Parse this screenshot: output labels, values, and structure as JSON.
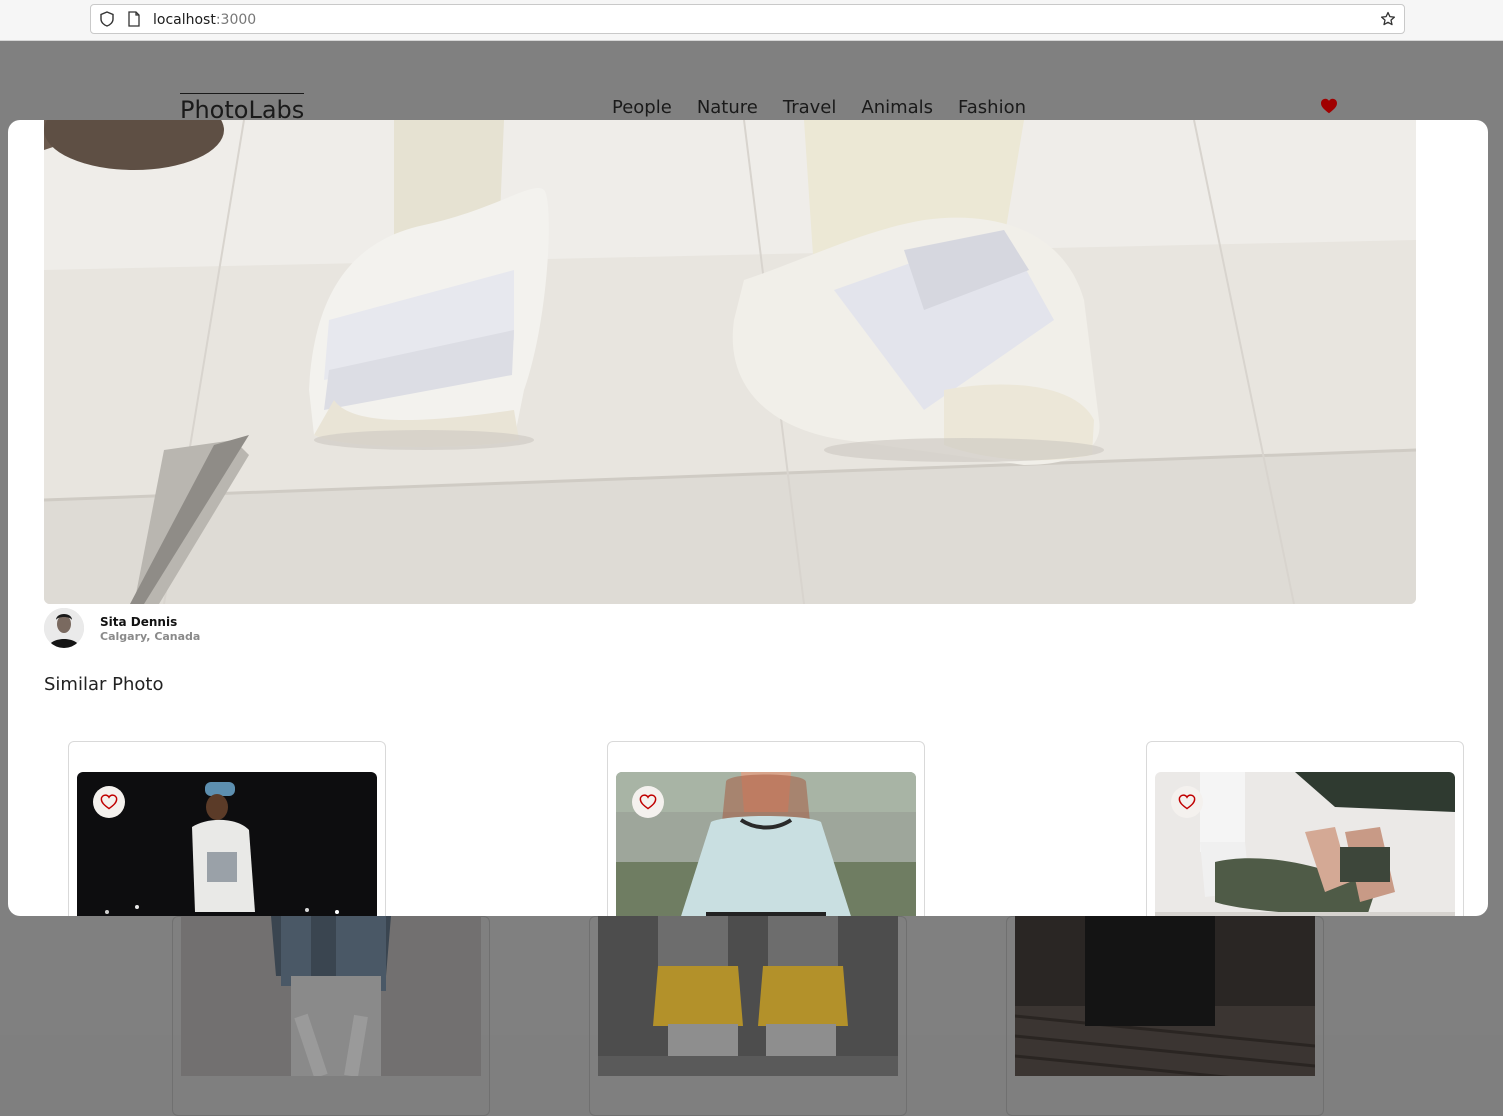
{
  "browser": {
    "url_host": "localhost",
    "url_port": ":3000"
  },
  "nav": {
    "logo": "PhotoLabs",
    "topics": [
      "People",
      "Nature",
      "Travel",
      "Animals",
      "Fashion"
    ],
    "fav_icon": "heart-filled-icon",
    "accent": "#c00000"
  },
  "modal": {
    "user": {
      "name": "Sita Dennis",
      "location": "Calgary, Canada"
    },
    "similar_heading": "Similar Photo",
    "similar_photos": [
      {
        "description": "man in cap at night",
        "fav_icon": "heart-outline-icon"
      },
      {
        "description": "woman in light blue top by lake",
        "fav_icon": "heart-outline-icon"
      },
      {
        "description": "person adjusting green sandals",
        "fav_icon": "heart-outline-icon"
      }
    ]
  }
}
